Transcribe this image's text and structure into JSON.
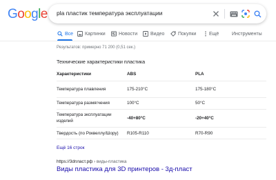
{
  "logo": {
    "letters": [
      "G",
      "o",
      "o",
      "g",
      "l",
      "e"
    ],
    "colors": [
      "#4285F4",
      "#EA4335",
      "#FBBC05",
      "#4285F4",
      "#34A853",
      "#EA4335"
    ]
  },
  "search": {
    "query": "pla пластик температура эксплуатации",
    "icons": [
      "close-icon",
      "keyboard-icon",
      "camera-lens-icon",
      "search-icon"
    ]
  },
  "tabs": [
    {
      "label": "Все",
      "icon": "search-icon",
      "active": true
    },
    {
      "label": "Картинки",
      "icon": "image-icon",
      "active": false
    },
    {
      "label": "Новости",
      "icon": "news-icon",
      "active": false
    },
    {
      "label": "Видео",
      "icon": "video-icon",
      "active": false
    },
    {
      "label": "Покупки",
      "icon": "tag-icon",
      "active": false
    },
    {
      "label": "Ещё",
      "icon": "more-vert-icon",
      "active": false
    }
  ],
  "tools_label": "Инструменты",
  "results_stats": "Результатов: примерно 71 200 (0,51 сек.)",
  "snippet": {
    "title": "Технические характеристики пластика",
    "headers": [
      "Характеристики",
      "ABS",
      "PLA"
    ],
    "rows": [
      {
        "name": "Температура плавления",
        "abs": "175-210°C",
        "pla": "175-180°C"
      },
      {
        "name": "Температура размягчения",
        "abs": "100°C",
        "pla": "50°C"
      },
      {
        "name_line1": "Температура эксплуатации",
        "name_line2": "изделий",
        "abs": "-40+80°C",
        "pla": "-20+40°C"
      },
      {
        "name": "Твердость (по Роквеллу/Шору)",
        "abs": "R105-R110",
        "pla": "R70-R90"
      }
    ],
    "more_link": "Ещё 16 строк"
  },
  "result": {
    "domain": "https://3dпласт.рф",
    "path": " › виды-пластика",
    "title": "Виды пластика для 3D принтеров - 3д-пласт"
  },
  "colors": {
    "accent": "#1a73e8",
    "link": "#1a0dab",
    "muted": "#5f6368"
  }
}
